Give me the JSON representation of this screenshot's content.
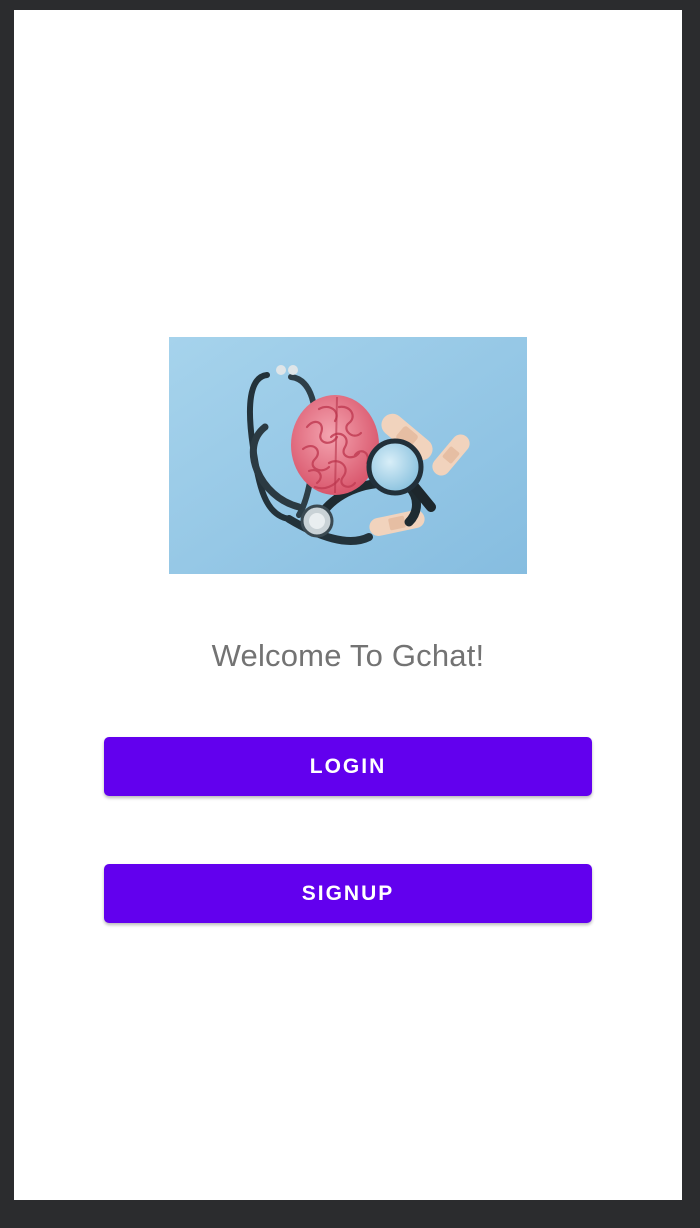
{
  "welcome": {
    "title": "Welcome To Gchat!"
  },
  "actions": {
    "login_label": "LOGIN",
    "signup_label": "SIGNUP"
  },
  "hero_image": {
    "description_icon": "stethoscope-brain-illustration"
  },
  "colors": {
    "accent": "#6200ee",
    "screen_background": "#ffffff",
    "frame_background": "#2b2c2e",
    "welcome_text": "#737373",
    "hero_background": "#9ccbe6"
  }
}
